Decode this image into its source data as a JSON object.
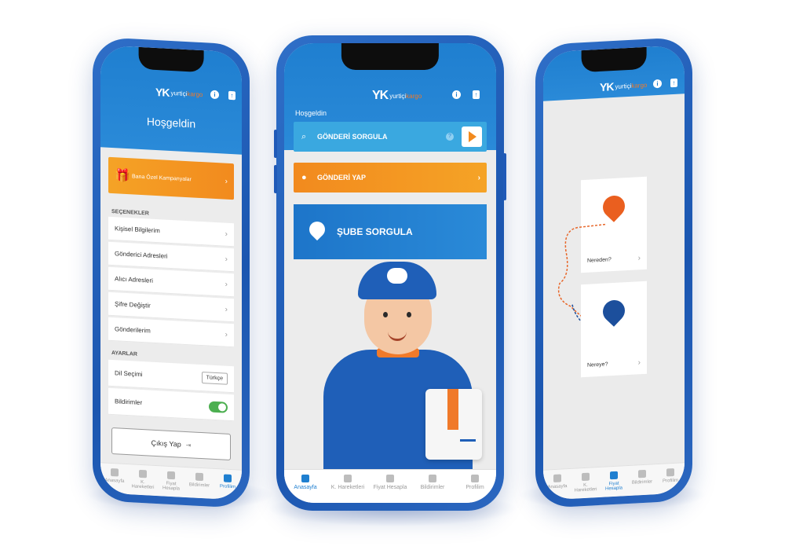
{
  "brand": {
    "mark": "YK",
    "word1": "yurtiçi",
    "word2": "kargo"
  },
  "left": {
    "title": "Hoşgeldin",
    "promo": "Bana Özel Kampanyalar",
    "section_options": "SEÇENEKLER",
    "options": [
      "Kişisel Bilgilerim",
      "Gönderici Adresleri",
      "Alıcı Adresleri",
      "Şifre Değiştir",
      "Gönderilerim"
    ],
    "section_settings": "AYARLAR",
    "language_label": "Dil Seçimi",
    "language_value": "Türkçe",
    "notifications_label": "Bildirimler",
    "logout": "Çıkış Yap",
    "active_tab": 4
  },
  "center": {
    "greeting": "Hoşgeldin",
    "query_label": "GÖNDERİ SORGULA",
    "send_label": "GÖNDERİ YAP",
    "branch_label": "ŞUBE SORGULA",
    "active_tab": 0
  },
  "right": {
    "from_label": "Nereden?",
    "to_label": "Nereye?",
    "active_tab": 2
  },
  "tabs": [
    "Anasayfa",
    "K. Hareketleri",
    "Fiyat Hesapla",
    "Bildirimler",
    "Profilim"
  ],
  "colors": {
    "blue": "#1f7fd0",
    "orange": "#f28a1e",
    "navy": "#1c4f9c"
  }
}
